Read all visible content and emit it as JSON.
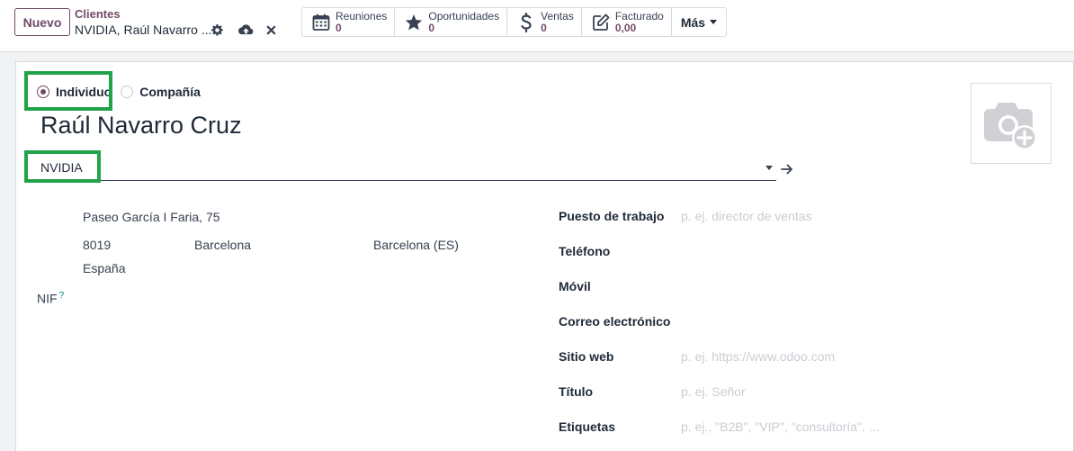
{
  "control_panel": {
    "new_label": "Nuevo",
    "breadcrumb_parent": "Clientes",
    "breadcrumb_current": "NVIDIA, Raúl Navarro ...",
    "icons": [
      "gear-icon",
      "cloud-upload-icon",
      "close-icon"
    ]
  },
  "smart_buttons": [
    {
      "label": "Reuniones",
      "value": "0",
      "icon": "calendar-icon"
    },
    {
      "label": "Oportunidades",
      "value": "0",
      "icon": "star-icon"
    },
    {
      "label": "Ventas",
      "value": "0",
      "icon": "dollar-icon"
    },
    {
      "label": "Facturado",
      "value": "0,00",
      "icon": "pencil-square-icon"
    },
    {
      "label": "Más"
    }
  ],
  "form": {
    "type_options": [
      {
        "label": "Individuo",
        "selected": true
      },
      {
        "label": "Compañía",
        "selected": false
      }
    ],
    "name": "Raúl Navarro Cruz",
    "company": "NVIDIA",
    "address": {
      "street": "Paseo García I Faria, 75",
      "zip": "8019",
      "city": "Barcelona",
      "state": "Barcelona (ES)",
      "country": "España"
    },
    "nif_label": "NIF",
    "nif_help": "?",
    "fields": [
      {
        "label": "Puesto de trabajo",
        "placeholder": "p. ej. director de ventas"
      },
      {
        "label": "Teléfono",
        "placeholder": ""
      },
      {
        "label": "Móvil",
        "placeholder": ""
      },
      {
        "label": "Correo electrónico",
        "placeholder": ""
      },
      {
        "label": "Sitio web",
        "placeholder": "p. ej. https://www.odoo.com"
      },
      {
        "label": "Título",
        "placeholder": "p. ej. Señor"
      },
      {
        "label": "Etiquetas",
        "placeholder": "p. ej., \"B2B\", \"VIP\", \"consultoría\", ..."
      }
    ]
  },
  "colors": {
    "brand": "#714b67",
    "highlight": "#22a34a",
    "help": "#017e84"
  }
}
